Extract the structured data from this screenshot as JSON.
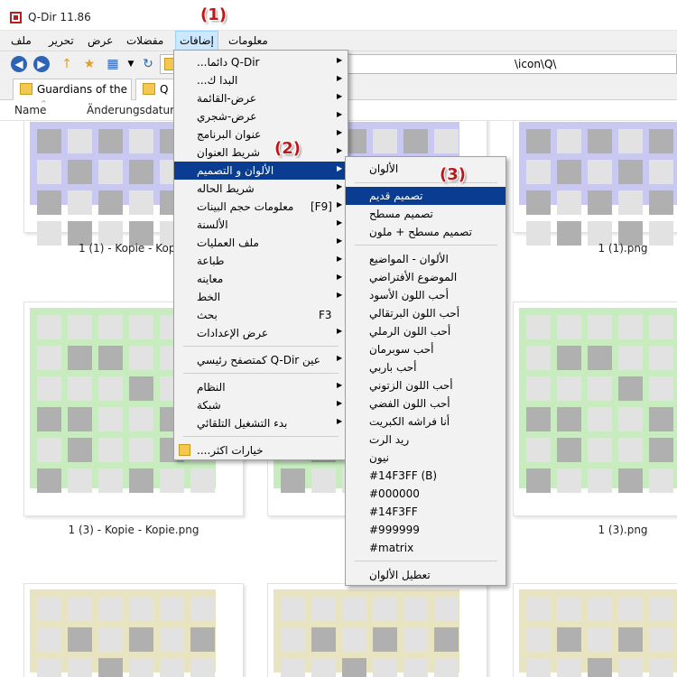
{
  "window": {
    "title": "Q-Dir 11.86"
  },
  "menubar": {
    "items": [
      "ملف",
      "تحرير",
      "عرض",
      "مفضلات",
      "إضافات",
      "معلومات"
    ]
  },
  "toolbar": {
    "path": "\\icon\\Q\\"
  },
  "tabs": [
    "Guardians of the ...",
    "Q"
  ],
  "columns": {
    "name": "Name",
    "date": "Änderungsdatum"
  },
  "thumbnails": [
    {
      "palette": "purple",
      "label": "1 (1) - Kopie - Kopie."
    },
    {
      "palette": "purple",
      "label": ""
    },
    {
      "palette": "purple",
      "label": "1 (1).png"
    },
    {
      "palette": "green",
      "label": "1 (3) - Kopie - Kopie.png"
    },
    {
      "palette": "green",
      "label": "1"
    },
    {
      "palette": "green",
      "label": "1 (3).png"
    },
    {
      "palette": "yellow",
      "label": ""
    },
    {
      "palette": "yellow",
      "label": ""
    },
    {
      "palette": "yellow",
      "label": ""
    }
  ],
  "extras_menu": {
    "items": [
      {
        "label": "Q-Dir دائما...",
        "arrow": true
      },
      {
        "label": "البدا ك...",
        "arrow": true
      },
      {
        "label": "عرض-القائمة",
        "arrow": true
      },
      {
        "label": "عرض-شجري",
        "arrow": true
      },
      {
        "label": "عنوان البرنامج",
        "arrow": true
      },
      {
        "label": "شريط العنوان",
        "arrow": true
      },
      {
        "label": "الألوان و التصميم",
        "arrow": true,
        "highlight": true
      },
      {
        "label": "شريط الحاله",
        "arrow": true
      },
      {
        "label": "معلومات حجم البينات",
        "shortcut": "[F9]",
        "arrow": true
      },
      {
        "label": "الألسنة",
        "arrow": true
      },
      {
        "label": "ملف العمليات",
        "arrow": true
      },
      {
        "label": "طباعة",
        "arrow": true
      },
      {
        "label": "معاينه",
        "arrow": true
      },
      {
        "label": "الخط",
        "arrow": true
      },
      {
        "label": "بحث",
        "shortcut": "F3"
      },
      {
        "label": "عرض الإعدادات",
        "arrow": true
      },
      {
        "label": "عين Q-Dir كمتصفح رئيسي",
        "arrow": true,
        "sep_before": true
      },
      {
        "label": "النظام",
        "arrow": true,
        "sep_before": true
      },
      {
        "label": "شبكة",
        "arrow": true
      },
      {
        "label": "بدء التشغيل التلقائي",
        "arrow": true
      },
      {
        "label": "خيارات اكثر....",
        "folder_icon": true,
        "sep_before": true
      }
    ]
  },
  "colors_menu": {
    "header": "الألوان",
    "items": [
      {
        "label": "تصميم قديم",
        "highlight": true
      },
      {
        "label": "تصميم مسطح"
      },
      {
        "label": "تصميم مسطح + ملون"
      },
      {
        "label": "الألوان - المواضيع",
        "sep_before": true
      },
      {
        "label": "الموضوع الأفتراضي"
      },
      {
        "label": "أحب اللون الأسود"
      },
      {
        "label": "أحب اللون البرتقالي"
      },
      {
        "label": "أحب اللون الرملي"
      },
      {
        "label": "أحب سوبرمان"
      },
      {
        "label": "أحب باربي"
      },
      {
        "label": "أحب اللون الزتوني"
      },
      {
        "label": "أحب اللون الفضي"
      },
      {
        "label": "أنا فراشه الكبريت"
      },
      {
        "label": "ريد الرت"
      },
      {
        "label": "نيون"
      },
      {
        "label": "#14F3FF (B)"
      },
      {
        "label": "#000000"
      },
      {
        "label": "#14F3FF"
      },
      {
        "label": "#999999"
      },
      {
        "label": "#matrix"
      },
      {
        "label": "تعطيل الألوان",
        "sep_before": true
      }
    ]
  },
  "callouts": [
    "(1)",
    "(2)",
    "(3)"
  ],
  "colors": {
    "highlight": "#0a3d91",
    "menu_bg": "#f2f2f2",
    "purple_bg": "#c8c8f0",
    "purple_line": "#b0b0ec",
    "green_bg": "#c8ecc0",
    "green_line": "#bde6b3",
    "yellow_bg": "#e8e3c0",
    "yellow_line": "#ddd8ac",
    "cell_light": "#e2e2e2",
    "cell_dark": "#b0b0b0",
    "callout": "#c01818"
  }
}
